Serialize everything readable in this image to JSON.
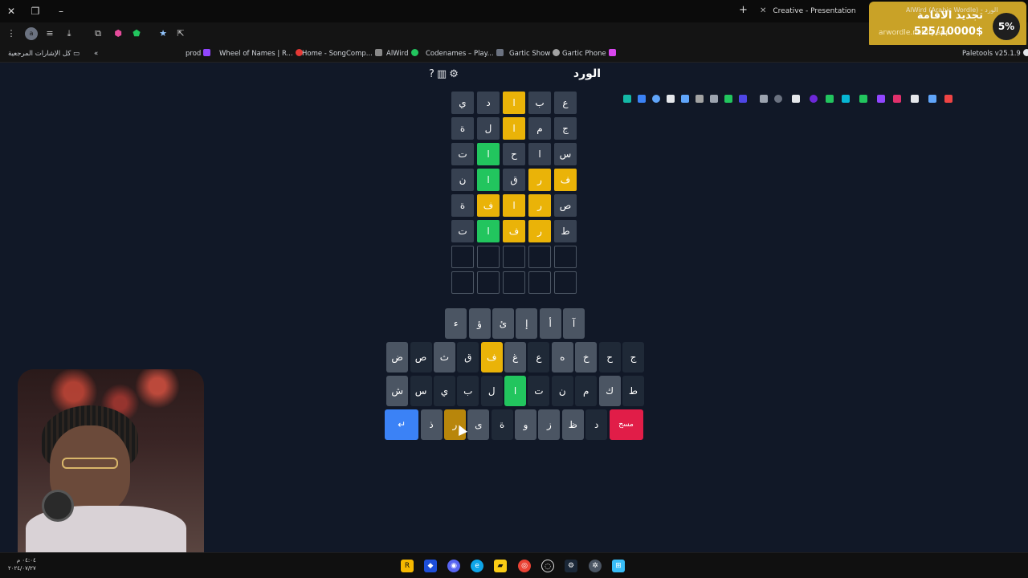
{
  "browser": {
    "tabs": [
      {
        "label": "Creative - Presentation"
      },
      {
        "label": "AlWird (Arabic Wordle) - الورد"
      }
    ],
    "bookmarks_folder": "كل الإشارات المرجعية",
    "bookmarks": [
      {
        "label": "prod"
      },
      {
        "label": "Wheel of Names | R..."
      },
      {
        "label": "Home - SongComp..."
      },
      {
        "label": "AlWird"
      },
      {
        "label": "Codenames – Play..."
      },
      {
        "label": "Gartic Show"
      },
      {
        "label": "Gartic Phone"
      },
      {
        "label": "Paletools v25.1.9"
      }
    ],
    "colors": {
      "accent": "#3b82f6",
      "present": "#eab308",
      "correct": "#22c55e",
      "absent": "#1f2937"
    }
  },
  "toast": {
    "title": "تجديد الاقامة",
    "subtitle": "arwordle.netlify.app",
    "amount": "525/10000$",
    "percent": "5%"
  },
  "game": {
    "title": "الورد",
    "icons": [
      "help-icon",
      "stats-icon",
      "settings-icon"
    ],
    "grid": [
      [
        {
          "l": "ع",
          "s": "absent"
        },
        {
          "l": "ب",
          "s": "absent"
        },
        {
          "l": "ا",
          "s": "present"
        },
        {
          "l": "د",
          "s": "absent"
        },
        {
          "l": "ي",
          "s": "absent"
        }
      ],
      [
        {
          "l": "ج",
          "s": "absent"
        },
        {
          "l": "م",
          "s": "absent"
        },
        {
          "l": "ا",
          "s": "present"
        },
        {
          "l": "ل",
          "s": "absent"
        },
        {
          "l": "ة",
          "s": "absent"
        }
      ],
      [
        {
          "l": "س",
          "s": "absent"
        },
        {
          "l": "ا",
          "s": "absent"
        },
        {
          "l": "ح",
          "s": "absent"
        },
        {
          "l": "ا",
          "s": "correct"
        },
        {
          "l": "ت",
          "s": "absent"
        }
      ],
      [
        {
          "l": "ف",
          "s": "present"
        },
        {
          "l": "ر",
          "s": "present"
        },
        {
          "l": "ق",
          "s": "absent"
        },
        {
          "l": "ا",
          "s": "correct"
        },
        {
          "l": "ن",
          "s": "absent"
        }
      ],
      [
        {
          "l": "ص",
          "s": "absent"
        },
        {
          "l": "ر",
          "s": "present"
        },
        {
          "l": "ا",
          "s": "present"
        },
        {
          "l": "ف",
          "s": "present"
        },
        {
          "l": "ة",
          "s": "absent"
        }
      ],
      [
        {
          "l": "ط",
          "s": "absent"
        },
        {
          "l": "ر",
          "s": "present"
        },
        {
          "l": "ف",
          "s": "present"
        },
        {
          "l": "ا",
          "s": "correct"
        },
        {
          "l": "ت",
          "s": "absent"
        }
      ],
      [
        {
          "l": "",
          "s": "empty"
        },
        {
          "l": "",
          "s": "empty"
        },
        {
          "l": "",
          "s": "empty"
        },
        {
          "l": "",
          "s": "empty"
        },
        {
          "l": "",
          "s": "empty"
        }
      ],
      [
        {
          "l": "",
          "s": "empty"
        },
        {
          "l": "",
          "s": "empty"
        },
        {
          "l": "",
          "s": "empty"
        },
        {
          "l": "",
          "s": "empty"
        },
        {
          "l": "",
          "s": "empty"
        }
      ]
    ],
    "keyboard": [
      [
        {
          "l": "آ",
          "s": "unused"
        },
        {
          "l": "أ",
          "s": "unused"
        },
        {
          "l": "إ",
          "s": "unused"
        },
        {
          "l": "ئ",
          "s": "unused"
        },
        {
          "l": "ؤ",
          "s": "unused"
        },
        {
          "l": "ء",
          "s": "unused"
        }
      ],
      [
        {
          "l": "ج",
          "s": "absent"
        },
        {
          "l": "ح",
          "s": "absent"
        },
        {
          "l": "خ",
          "s": "unused"
        },
        {
          "l": "ه",
          "s": "unused"
        },
        {
          "l": "ع",
          "s": "absent"
        },
        {
          "l": "غ",
          "s": "unused"
        },
        {
          "l": "ف",
          "s": "present"
        },
        {
          "l": "ق",
          "s": "absent"
        },
        {
          "l": "ث",
          "s": "unused"
        },
        {
          "l": "ص",
          "s": "absent"
        },
        {
          "l": "ض",
          "s": "unused"
        }
      ],
      [
        {
          "l": "ط",
          "s": "absent"
        },
        {
          "l": "ك",
          "s": "unused"
        },
        {
          "l": "م",
          "s": "absent"
        },
        {
          "l": "ن",
          "s": "absent"
        },
        {
          "l": "ت",
          "s": "absent"
        },
        {
          "l": "ا",
          "s": "correct"
        },
        {
          "l": "ل",
          "s": "absent"
        },
        {
          "l": "ب",
          "s": "absent"
        },
        {
          "l": "ي",
          "s": "absent"
        },
        {
          "l": "س",
          "s": "absent"
        },
        {
          "l": "ش",
          "s": "unused"
        }
      ],
      [
        {
          "l": "مسح",
          "s": "delete"
        },
        {
          "l": "د",
          "s": "absent"
        },
        {
          "l": "ظ",
          "s": "unused"
        },
        {
          "l": "ز",
          "s": "unused"
        },
        {
          "l": "و",
          "s": "unused"
        },
        {
          "l": "ة",
          "s": "absent"
        },
        {
          "l": "ى",
          "s": "unused"
        },
        {
          "l": "ر",
          "s": "hover"
        },
        {
          "l": "ذ",
          "s": "unused"
        },
        {
          "l": "↵",
          "s": "enter"
        }
      ]
    ]
  },
  "taskbar": {
    "clock_time": "٠٤:٠٤ م",
    "clock_date": "٢٠٢٤/٠٧/٢٧"
  }
}
